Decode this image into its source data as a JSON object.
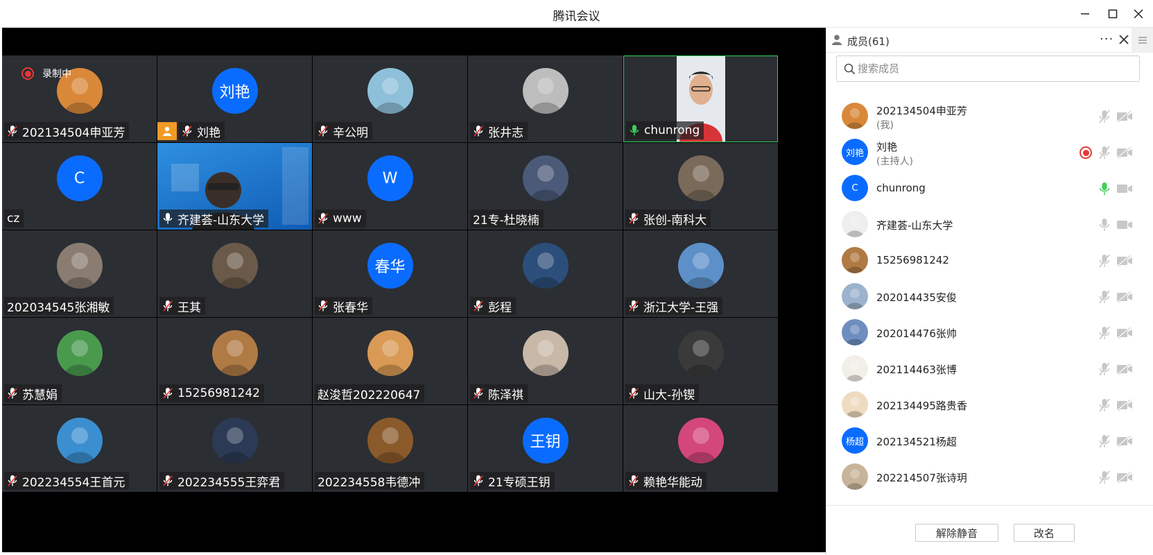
{
  "app": {
    "title": "腾讯会议"
  },
  "recording": {
    "label": "录制中"
  },
  "tiles": [
    {
      "name": "202134504申亚芳",
      "avatar": "photo-sunset",
      "color": "#d9883a",
      "mic": "muted"
    },
    {
      "name": "刘艳",
      "avatar_text": "刘艳",
      "mic": "muted",
      "host": true
    },
    {
      "name": "辛公明",
      "avatar": "photo-beach",
      "color": "#8fc0da",
      "mic": "muted"
    },
    {
      "name": "张井志",
      "avatar": "photo-sketch",
      "color": "#bdbdbd",
      "mic": "muted"
    },
    {
      "name": "chunrong",
      "avatar": "video-person",
      "color": "#d7343a",
      "mic": "active",
      "video": true
    },
    {
      "name": "cz",
      "avatar_text": "C",
      "mic": "none"
    },
    {
      "name": "齐建荟-山东大学",
      "avatar": "video-forum",
      "color": "#1e7fc9",
      "mic": "on",
      "video": true,
      "forum": true
    },
    {
      "name": "www",
      "avatar_text": "W",
      "mic": "muted"
    },
    {
      "name": "21专-杜晓楠",
      "avatar": "photo-dusk",
      "color": "#4b5a78",
      "mic": "none"
    },
    {
      "name": "张创-南科大",
      "avatar": "photo-collage",
      "color": "#7a6a5a",
      "mic": "muted"
    },
    {
      "name": "202034545张湘敏",
      "avatar": "photo-dog",
      "color": "#8a7c70",
      "mic": "none"
    },
    {
      "name": "王其",
      "avatar": "photo-astronaut",
      "color": "#6b5a4a",
      "mic": "muted"
    },
    {
      "name": "张春华",
      "avatar_text": "春华",
      "mic": "muted"
    },
    {
      "name": "彭程",
      "avatar": "photo-lake",
      "color": "#2c4e7a",
      "mic": "muted"
    },
    {
      "name": "浙江大学-王强",
      "avatar": "photo-harbor",
      "color": "#5d90c8",
      "mic": "muted"
    },
    {
      "name": "苏慧娟",
      "avatar": "photo-meadow",
      "color": "#4a9a4e",
      "mic": "muted"
    },
    {
      "name": "15256981242",
      "avatar": "photo-hamster",
      "color": "#b07a44",
      "mic": "muted"
    },
    {
      "name": "赵浚哲202220647",
      "avatar": "photo-cat",
      "color": "#d99a55",
      "mic": "none"
    },
    {
      "name": "陈泽祺",
      "avatar": "photo-pig",
      "color": "#c8b8a8",
      "mic": "muted"
    },
    {
      "name": "山大-孙锲",
      "avatar": "photo-night",
      "color": "#3a3a3a",
      "mic": "muted"
    },
    {
      "name": "202234554王首元",
      "avatar": "photo-cartoon",
      "color": "#3b8fd0",
      "mic": "muted"
    },
    {
      "name": "202234555王弈君",
      "avatar": "photo-cats",
      "color": "#2c3a55",
      "mic": "muted"
    },
    {
      "name": "202234558韦德冲",
      "avatar": "photo-groot",
      "color": "#8b5a2b",
      "mic": "none"
    },
    {
      "name": "21专硕王钥",
      "avatar_text": "王钥",
      "mic": "muted"
    },
    {
      "name": "赖艳华能动",
      "avatar": "photo-flower",
      "color": "#d4477a",
      "mic": "muted"
    }
  ],
  "panel": {
    "title": "成员(61)",
    "more": "···",
    "search_placeholder": "搜索成员",
    "members": [
      {
        "name": "202134504申亚芳",
        "role": "(我)",
        "avatar": "photo-sunset",
        "color": "#d9883a",
        "mic": "muted",
        "cam": "off"
      },
      {
        "name": "刘艳",
        "role": "(主持人)",
        "avatar_text": "刘艳",
        "mic": "muted",
        "cam": "off",
        "recording": true
      },
      {
        "name": "chunrong",
        "avatar_text": "C",
        "mic": "active",
        "cam": "on"
      },
      {
        "name": "齐建荟-山东大学",
        "avatar": "photo-sketch",
        "color": "#eeeeee",
        "mic": "on",
        "cam": "on"
      },
      {
        "name": "15256981242",
        "avatar": "photo-hamster",
        "color": "#b07a44",
        "mic": "muted",
        "cam": "off"
      },
      {
        "name": "202014435安俊",
        "avatar": "photo-beach",
        "color": "#9bb3cc",
        "mic": "muted",
        "cam": "off"
      },
      {
        "name": "202014476张帅",
        "avatar": "photo-lake",
        "color": "#6e8ec0",
        "mic": "muted",
        "cam": "off"
      },
      {
        "name": "202114463张博",
        "avatar": "photo-anime",
        "color": "#f2efe8",
        "mic": "muted",
        "cam": "off"
      },
      {
        "name": "202134495路贵香",
        "avatar": "photo-anime2",
        "color": "#efdcc0",
        "mic": "muted",
        "cam": "off"
      },
      {
        "name": "202134521杨超",
        "avatar_text": "杨超",
        "mic": "muted",
        "cam": "off"
      },
      {
        "name": "202214507张诗玥",
        "avatar": "photo-face",
        "color": "#c8b49a",
        "mic": "muted",
        "cam": "off"
      }
    ],
    "buttons": {
      "unmute": "解除静音",
      "rename": "改名"
    }
  }
}
